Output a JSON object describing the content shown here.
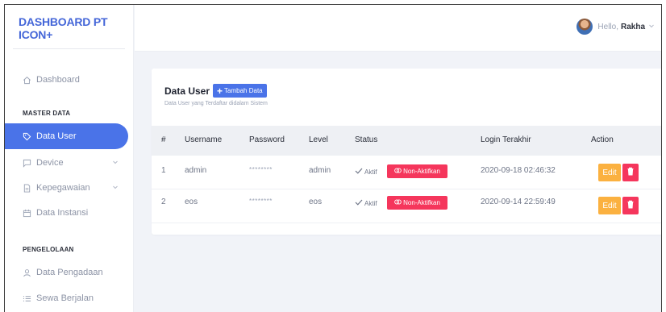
{
  "brand": "DASHBOARD PT ICON+",
  "nav": {
    "dashboard": "Dashboard",
    "section_master": "MASTER DATA",
    "data_user": "Data User",
    "device": "Device",
    "kepegawaian": "Kepegawaian",
    "data_instansi": "Data Instansi",
    "section_pengelolaan": "PENGELOLAAN",
    "data_pengadaan": "Data Pengadaan",
    "sewa_berjalan": "Sewa Berjalan"
  },
  "topbar": {
    "greeting": "Hello,",
    "user_name": "Rakha"
  },
  "card": {
    "title": "Data User",
    "add_button": "Tambah Data",
    "subtitle": "Data User yang Terdaftar didalam Sistem"
  },
  "table": {
    "headers": [
      "#",
      "Username",
      "Password",
      "Level",
      "Status",
      "Login Terakhir",
      "Action"
    ],
    "rows": [
      {
        "no": "1",
        "username": "admin",
        "password": "********",
        "level": "admin",
        "status": "Aktif",
        "toggle": "Non-Aktifkan",
        "login": "2020-09-18 02:46:32",
        "edit": "Edit"
      },
      {
        "no": "2",
        "username": "eos",
        "password": "********",
        "level": "eos",
        "status": "Aktif",
        "toggle": "Non-Aktifkan",
        "login": "2020-09-14 22:59:49",
        "edit": "Edit"
      }
    ]
  },
  "colors": {
    "primary": "#4a73e8",
    "danger": "#f5365c",
    "warning": "#fbb140"
  }
}
